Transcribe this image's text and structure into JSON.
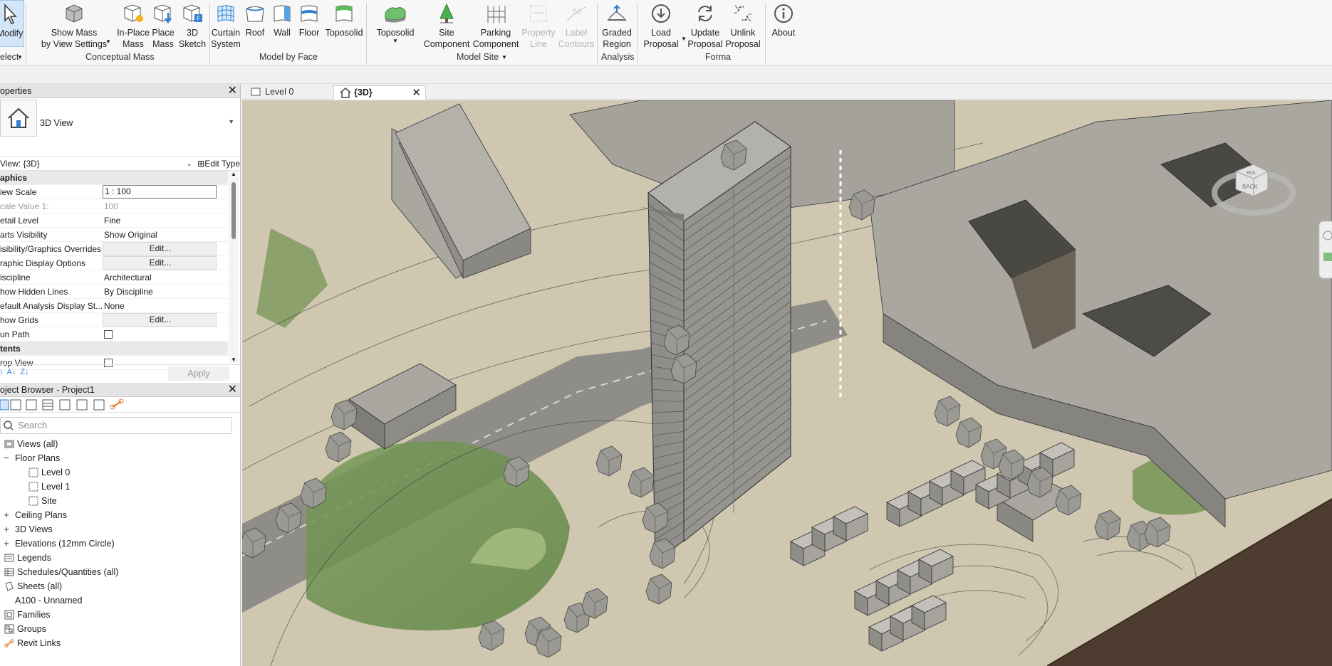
{
  "ribbon": {
    "tools": [
      {
        "id": "modify",
        "label1": "Modify",
        "label2": ""
      },
      {
        "id": "show-mass",
        "label1": "Show Mass",
        "label2": "by View Settings"
      },
      {
        "id": "in-place-mass",
        "label1": "In-Place",
        "label2": "Mass"
      },
      {
        "id": "place-mass",
        "label1": "Place",
        "label2": "Mass"
      },
      {
        "id": "3d-sketch",
        "label1": "3D",
        "label2": "Sketch"
      },
      {
        "id": "curtain-system",
        "label1": "Curtain",
        "label2": "System"
      },
      {
        "id": "roof",
        "label1": "Roof",
        "label2": ""
      },
      {
        "id": "wall",
        "label1": "Wall",
        "label2": ""
      },
      {
        "id": "floor",
        "label1": "Floor",
        "label2": ""
      },
      {
        "id": "toposolid-face",
        "label1": "Toposolid",
        "label2": ""
      },
      {
        "id": "toposolid",
        "label1": "Toposolid",
        "label2": ""
      },
      {
        "id": "site-component",
        "label1": "Site",
        "label2": "Component"
      },
      {
        "id": "parking-component",
        "label1": "Parking",
        "label2": "Component"
      },
      {
        "id": "property-line",
        "label1": "Property",
        "label2": "Line"
      },
      {
        "id": "label-contours",
        "label1": "Label",
        "label2": "Contours"
      },
      {
        "id": "graded-region",
        "label1": "Graded",
        "label2": "Region"
      },
      {
        "id": "load-proposal",
        "label1": "Load",
        "label2": "Proposal"
      },
      {
        "id": "update-proposal",
        "label1": "Update",
        "label2": "Proposal"
      },
      {
        "id": "unlink-proposal",
        "label1": "Unlink",
        "label2": "Proposal"
      },
      {
        "id": "about",
        "label1": "About",
        "label2": ""
      }
    ],
    "panels": {
      "select": "elect",
      "conceptual_mass": "Conceptual Mass",
      "model_by_face": "Model by Face",
      "model_site": "Model Site",
      "analysis": "Analysis",
      "forma": "Forma"
    }
  },
  "properties": {
    "title": "operties",
    "type_name": "3D View",
    "view_selector": "View: {3D}",
    "edit_type": "Edit Type",
    "rows": [
      {
        "type": "cat",
        "k": "aphics",
        "v": ""
      },
      {
        "type": "box",
        "k": "iew Scale",
        "v": "1 : 100"
      },
      {
        "type": "dim",
        "k": "cale Value    1:",
        "v": "100"
      },
      {
        "type": "text",
        "k": "etail Level",
        "v": "Fine"
      },
      {
        "type": "text",
        "k": "arts Visibility",
        "v": "Show Original"
      },
      {
        "type": "btn",
        "k": "isibility/Graphics Overrides",
        "v": "Edit..."
      },
      {
        "type": "btn",
        "k": "raphic Display Options",
        "v": "Edit..."
      },
      {
        "type": "text",
        "k": "iscipline",
        "v": "Architectural"
      },
      {
        "type": "text",
        "k": "how Hidden Lines",
        "v": "By Discipline"
      },
      {
        "type": "text",
        "k": "efault Analysis Display St...",
        "v": "None"
      },
      {
        "type": "btn",
        "k": "how Grids",
        "v": "Edit..."
      },
      {
        "type": "chk",
        "k": "un Path",
        "v": ""
      },
      {
        "type": "cat",
        "k": "tents",
        "v": ""
      },
      {
        "type": "chk",
        "k": "rop View",
        "v": ""
      }
    ],
    "apply": "Apply"
  },
  "project_browser": {
    "title": "oject Browser - Project1",
    "search_placeholder": "Search",
    "tree": [
      {
        "level": 0,
        "toggle": "",
        "label": "Views (all)",
        "icon": "views"
      },
      {
        "level": 1,
        "toggle": "−",
        "label": "Floor Plans",
        "icon": ""
      },
      {
        "level": 2,
        "toggle": "",
        "label": "Level 0",
        "icon": "plan"
      },
      {
        "level": 2,
        "toggle": "",
        "label": "Level 1",
        "icon": "plan"
      },
      {
        "level": 2,
        "toggle": "",
        "label": "Site",
        "icon": "plan"
      },
      {
        "level": 1,
        "toggle": "+",
        "label": "Ceiling Plans",
        "icon": ""
      },
      {
        "level": 1,
        "toggle": "+",
        "label": "3D Views",
        "icon": ""
      },
      {
        "level": 1,
        "toggle": "+",
        "label": "Elevations (12mm Circle)",
        "icon": ""
      },
      {
        "level": 0,
        "toggle": "",
        "label": "Legends",
        "icon": "legend"
      },
      {
        "level": 0,
        "toggle": "",
        "label": "Schedules/Quantities (all)",
        "icon": "schedule"
      },
      {
        "level": 0,
        "toggle": "",
        "label": "Sheets (all)",
        "icon": "sheet"
      },
      {
        "level": 1,
        "toggle": "",
        "label": "A100 - Unnamed",
        "icon": ""
      },
      {
        "level": 0,
        "toggle": "",
        "label": "Families",
        "icon": "family"
      },
      {
        "level": 0,
        "toggle": "",
        "label": "Groups",
        "icon": "group"
      },
      {
        "level": 0,
        "toggle": "",
        "label": "Revit Links",
        "icon": "link"
      }
    ]
  },
  "tabs": [
    {
      "label": "Level 0"
    },
    {
      "label": "{3D}"
    }
  ],
  "viewcube": {
    "front": "BACK",
    "top": "BOL"
  },
  "colors": {
    "accent": "#2f7fd1",
    "mass": "#a9a7a0",
    "terrain": "#c6bfa8"
  }
}
